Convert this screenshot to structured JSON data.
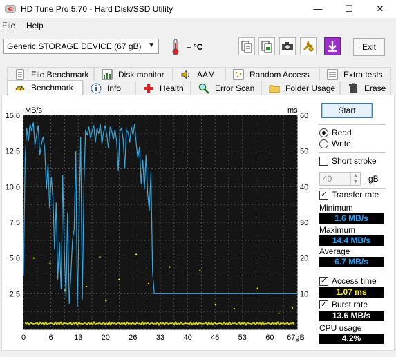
{
  "window": {
    "title": "HD Tune Pro 5.70 - Hard Disk/SSD Utility",
    "minimize": "—",
    "maximize": "☐",
    "close": "✕"
  },
  "menu": {
    "file": "File",
    "help": "Help"
  },
  "toolbar": {
    "device": "Generic STORAGE DEVICE (67 gB)",
    "temperature": "– °C",
    "exit": "Exit"
  },
  "tabs_top": [
    {
      "label": "File Benchmark",
      "icon": "file-benchmark-icon"
    },
    {
      "label": "Disk monitor",
      "icon": "disk-monitor-icon"
    },
    {
      "label": "AAM",
      "icon": "speaker-icon"
    },
    {
      "label": "Random Access",
      "icon": "random-access-icon"
    },
    {
      "label": "Extra tests",
      "icon": "extra-tests-icon"
    }
  ],
  "tabs_bottom": [
    {
      "label": "Benchmark",
      "icon": "benchmark-icon"
    },
    {
      "label": "Info",
      "icon": "info-icon"
    },
    {
      "label": "Health",
      "icon": "health-cross-icon"
    },
    {
      "label": "Error Scan",
      "icon": "magnifier-icon"
    },
    {
      "label": "Folder Usage",
      "icon": "folder-icon"
    },
    {
      "label": "Erase",
      "icon": "trash-icon"
    }
  ],
  "controls": {
    "start": "Start",
    "read": "Read",
    "write": "Write",
    "short_stroke": "Short stroke",
    "short_stroke_value": "40",
    "short_stroke_unit": "gB",
    "transfer_rate": "Transfer rate",
    "access_time": "Access time",
    "burst_rate": "Burst rate",
    "check_mark": "✓"
  },
  "stats": {
    "minimum_label": "Minimum",
    "minimum": "1.6 MB/s",
    "maximum_label": "Maximum",
    "maximum": "14.4 MB/s",
    "average_label": "Average",
    "average": "6.7 MB/s",
    "access_time": "1.07 ms",
    "burst_rate": "13.6 MB/s",
    "cpu_label": "CPU usage",
    "cpu": "4.2%"
  },
  "colors": {
    "transfer": "#38a9e0",
    "access": "#f5f200",
    "chart_bg": "#151515",
    "grid": "#505050"
  },
  "chart_data": {
    "type": "line",
    "y_left_label": "MB/s",
    "y_right_label": "ms",
    "y_left_ticks": [
      "15.0",
      "12.5",
      "10.0",
      "7.5",
      "5.0",
      "2.5"
    ],
    "y_right_ticks": [
      "60",
      "50",
      "40",
      "30",
      "20",
      "10"
    ],
    "x_ticks": [
      "0",
      "6",
      "13",
      "20",
      "26",
      "33",
      "40",
      "46",
      "53",
      "60",
      "67gB"
    ],
    "ylim_left": [
      0,
      15
    ],
    "ylim_right": [
      0,
      60
    ],
    "xlim": [
      0,
      67
    ],
    "grid": true,
    "series": [
      {
        "name": "Transfer rate",
        "axis": "left",
        "x": [
          0,
          0.4,
          0.8,
          1.2,
          1.6,
          2.0,
          2.4,
          2.8,
          3.2,
          3.6,
          4.0,
          4.4,
          4.8,
          5.2,
          5.6,
          6.0,
          6.4,
          6.8,
          7.2,
          7.6,
          8.0,
          8.4,
          8.8,
          9.2,
          9.6,
          10.0,
          10.4,
          10.8,
          11.2,
          11.6,
          12.0,
          12.4,
          12.8,
          13.2,
          13.6,
          14.0,
          14.4,
          14.8,
          15.2,
          15.6,
          16.0,
          16.4,
          16.8,
          17.2,
          17.6,
          18.0,
          18.4,
          18.8,
          19.2,
          19.6,
          20.0,
          20.4,
          20.8,
          21.2,
          21.6,
          22.0,
          22.4,
          22.8,
          23.2,
          23.6,
          24.0,
          24.4,
          24.8,
          25.2,
          25.6,
          26.0,
          26.4,
          26.8,
          27.2,
          27.6,
          28.0,
          28.4,
          28.8,
          29.2,
          29.6,
          30.0,
          30.4,
          30.8,
          31.2,
          31.6,
          32.0,
          67
        ],
        "y": [
          3.8,
          12.0,
          14.1,
          13.2,
          14.4,
          13.9,
          14.5,
          12.9,
          13.6,
          14.3,
          12.2,
          13.0,
          13.5,
          12.7,
          9.8,
          11.6,
          8.5,
          10.7,
          9.2,
          5.6,
          8.9,
          3.5,
          6.1,
          2.8,
          10.8,
          5.4,
          2.2,
          8.2,
          1.8,
          3.9,
          6.3,
          7.0,
          12.5,
          1.6,
          7.5,
          13.5,
          2.1,
          10.2,
          14.0,
          13.6,
          14.2,
          13.4,
          13.9,
          14.3,
          13.1,
          14.1,
          13.7,
          14.4,
          13.0,
          13.8,
          14.3,
          13.6,
          12.7,
          14.2,
          13.9,
          13.3,
          14.0,
          13.2,
          11.1,
          13.9,
          14.1,
          13.3,
          11.3,
          14.0,
          13.8,
          13.1,
          14.2,
          13.6,
          14.4,
          13.0,
          12.0,
          12.8,
          10.2,
          11.9,
          9.8,
          12.2,
          9.5,
          8.3,
          11.0,
          4.0,
          2.5,
          2.5
        ]
      },
      {
        "name": "Access time",
        "axis": "right",
        "type": "scatter",
        "x": [
          2.5,
          6.5,
          10.2,
          15.4,
          18.7,
          20.2,
          23.4,
          27.6,
          30.6,
          35.8,
          43.2,
          47.0,
          51.6,
          57.3,
          62.5,
          65.8
        ],
        "y": [
          20.0,
          18.5,
          11.0,
          12.0,
          20.3,
          8.0,
          14.0,
          21.0,
          12.8,
          17.5,
          16.5,
          7.0,
          5.8,
          11.5,
          4.5,
          6.0
        ],
        "baseline_ms": 1.07
      }
    ]
  }
}
